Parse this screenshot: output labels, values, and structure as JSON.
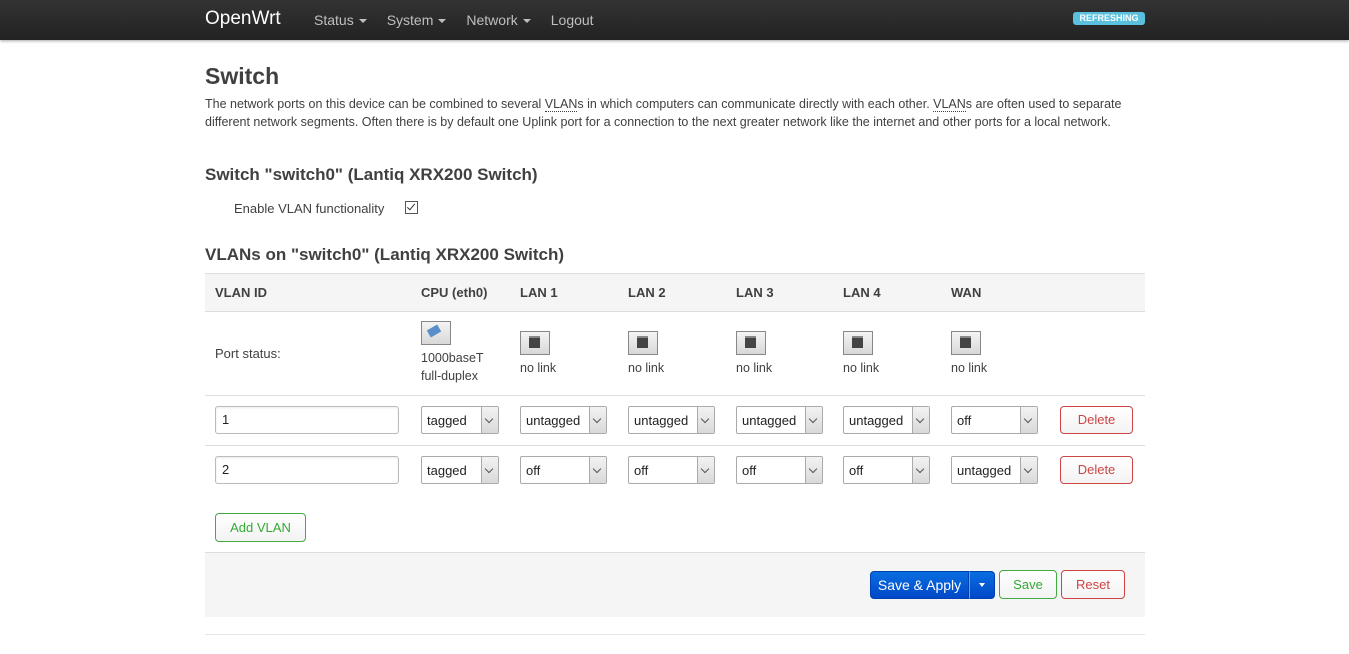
{
  "header": {
    "brand": "OpenWrt",
    "nav": [
      {
        "label": "Status"
      },
      {
        "label": "System"
      },
      {
        "label": "Network"
      },
      {
        "label": "Logout"
      }
    ],
    "refresh_badge": "REFRESHING"
  },
  "page": {
    "title": "Switch",
    "description_parts": [
      "The network ports on this device can be combined to several ",
      "VLAN",
      "s in which computers can communicate directly with each other. ",
      "VLAN",
      "s are often used to separate different network segments. Often there is by default one Uplink port for a connection to the next greater network like the internet and other ports for a local network."
    ],
    "switch_heading": "Switch \"switch0\" (Lantiq XRX200 Switch)",
    "enable_vlan_label": "Enable VLAN functionality",
    "enable_vlan_checked": true,
    "vlans_heading": "VLANs on \"switch0\" (Lantiq XRX200 Switch)"
  },
  "table": {
    "headers": [
      "VLAN ID",
      "CPU (eth0)",
      "LAN 1",
      "LAN 2",
      "LAN 3",
      "LAN 4",
      "WAN"
    ],
    "port_status_label": "Port status:",
    "ports": [
      {
        "status": "up",
        "line1": "1000baseT",
        "line2": "full-duplex"
      },
      {
        "status": "down",
        "line1": "no link",
        "line2": ""
      },
      {
        "status": "down",
        "line1": "no link",
        "line2": ""
      },
      {
        "status": "down",
        "line1": "no link",
        "line2": ""
      },
      {
        "status": "down",
        "line1": "no link",
        "line2": ""
      },
      {
        "status": "down",
        "line1": "no link",
        "line2": ""
      }
    ],
    "rows": [
      {
        "vlan_id": "1",
        "values": [
          "tagged",
          "untagged",
          "untagged",
          "untagged",
          "untagged",
          "off"
        ],
        "delete_label": "Delete"
      },
      {
        "vlan_id": "2",
        "values": [
          "tagged",
          "off",
          "off",
          "off",
          "off",
          "untagged"
        ],
        "delete_label": "Delete"
      }
    ],
    "add_label": "Add VLAN"
  },
  "actions": {
    "save_apply": "Save & Apply",
    "save": "Save",
    "reset": "Reset"
  }
}
